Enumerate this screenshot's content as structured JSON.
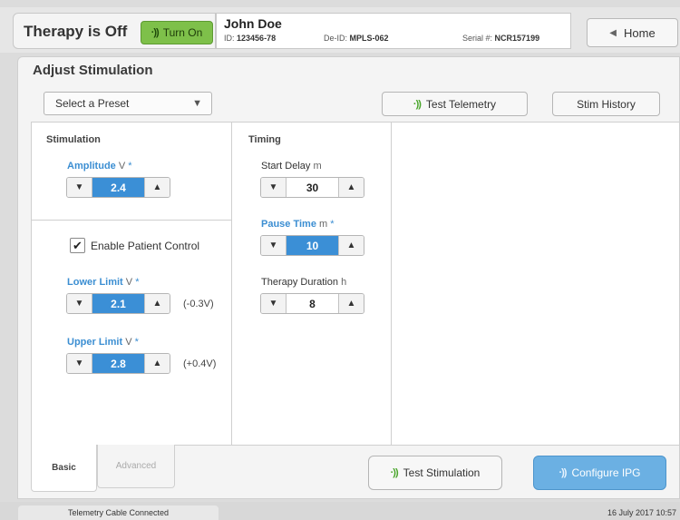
{
  "header": {
    "therapy_status": "Therapy is Off",
    "turn_on_label": "Turn On",
    "patient_name": "John Doe",
    "id_label": "ID:",
    "id_value": "123456-78",
    "deid_label": "De-ID:",
    "deid_value": "MPLS-062",
    "serial_label": "Serial #:",
    "serial_value": "NCR157199",
    "home_label": "Home"
  },
  "panel": {
    "title": "Adjust Stimulation",
    "preset_placeholder": "Select a Preset",
    "test_telemetry_label": "Test Telemetry",
    "stim_history_label": "Stim History"
  },
  "stimulation": {
    "section_label": "Stimulation",
    "amplitude": {
      "label": "Amplitude",
      "unit": "V",
      "star": "*",
      "value": "2.4"
    },
    "enable_patient_control_label": "Enable Patient Control",
    "enable_patient_control_checked": true,
    "lower_limit": {
      "label": "Lower Limit",
      "unit": "V",
      "star": "*",
      "value": "2.1",
      "offset": "(-0.3V)"
    },
    "upper_limit": {
      "label": "Upper Limit",
      "unit": "V",
      "star": "*",
      "value": "2.8",
      "offset": "(+0.4V)"
    }
  },
  "timing": {
    "section_label": "Timing",
    "start_delay": {
      "label": "Start Delay",
      "unit": "m",
      "value": "30"
    },
    "pause_time": {
      "label": "Pause Time",
      "unit": "m",
      "star": "*",
      "value": "10"
    },
    "therapy_duration": {
      "label": "Therapy Duration",
      "unit": "h",
      "value": "8"
    }
  },
  "tabs": {
    "basic": "Basic",
    "advanced": "Advanced"
  },
  "actions": {
    "test_stimulation_label": "Test Stimulation",
    "configure_label": "Configure IPG"
  },
  "footer": {
    "status": "Telemetry Cable Connected",
    "date": "16 July 2017 10:57"
  },
  "colors": {
    "accent_blue": "#3b8fd6",
    "turn_on_green": "#7ec04a",
    "configure_blue": "#6bb0e3"
  }
}
